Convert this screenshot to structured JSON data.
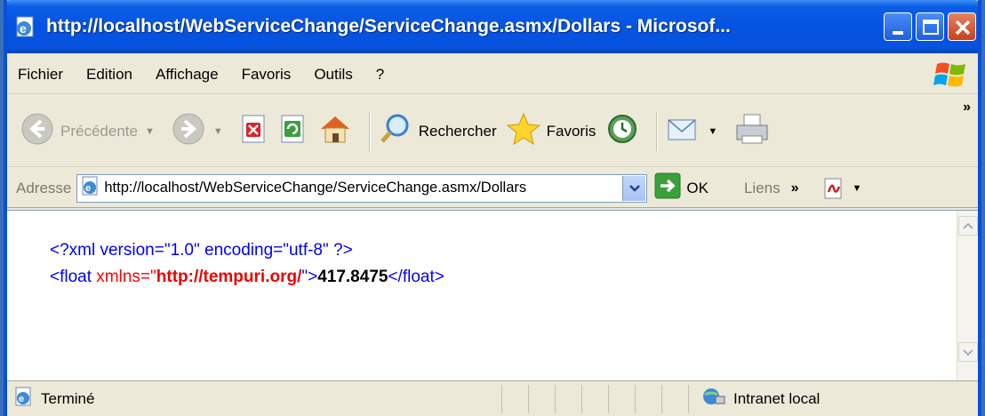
{
  "window": {
    "title": "http://localhost/WebServiceChange/ServiceChange.asmx/Dollars - Microsof..."
  },
  "menu": {
    "items": [
      "Fichier",
      "Edition",
      "Affichage",
      "Favoris",
      "Outils",
      "?"
    ]
  },
  "toolbar": {
    "back_label": "Précédente",
    "search_label": "Rechercher",
    "favorites_label": "Favoris",
    "overflow": "»"
  },
  "address": {
    "label": "Adresse",
    "url": "http://localhost/WebServiceChange/ServiceChange.asmx/Dollars",
    "go_label": "OK",
    "links_label": "Liens",
    "links_overflow": "»"
  },
  "content": {
    "declaration": "<?xml version=\"1.0\" encoding=\"utf-8\" ?>",
    "open_tag_start": "<float ",
    "attr_name": "xmlns=\"",
    "attr_value": "http://tempuri.org/",
    "open_tag_end": "\">",
    "value": "417.8475",
    "close_tag": "</float>"
  },
  "status": {
    "text": "Terminé",
    "zone": "Intranet local"
  },
  "colors": {
    "titlebar": "#0553e1",
    "chrome": "#ece9d8",
    "xml_tag": "#0000ff",
    "xml_attr": "#ff0000"
  }
}
